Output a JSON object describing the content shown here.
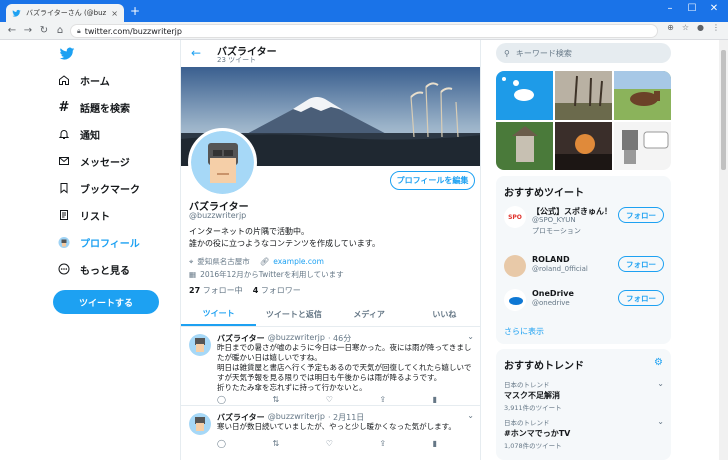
{
  "browser": {
    "tab_title": "バズライターさん (@buzzwriterjp) / T",
    "tab_close": "×",
    "new_tab": "+",
    "url": "twitter.com/buzzwriterjp",
    "win_min": "–",
    "win_max": "☐",
    "win_close": "✕"
  },
  "nav": {
    "items": [
      {
        "label": "ホーム"
      },
      {
        "label": "話題を検索"
      },
      {
        "label": "通知"
      },
      {
        "label": "メッセージ"
      },
      {
        "label": "ブックマーク"
      },
      {
        "label": "リスト"
      },
      {
        "label": "プロフィール"
      },
      {
        "label": "もっと見る"
      }
    ],
    "tweet_button": "ツイートする"
  },
  "header": {
    "name": "バズライター",
    "tweet_count": "23 ツイート"
  },
  "profile": {
    "edit_button": "プロフィールを編集",
    "name": "バズライター",
    "handle": "@buzzwriterjp",
    "bio_line1": "インターネットの片隅で活動中。",
    "bio_line2": "誰かの役に立つようなコンテンツを作成しています。",
    "location": "愛知県名古屋市",
    "website": "example.com",
    "joined": "2016年12月からTwitterを利用しています",
    "following_count": "27",
    "following_label": "フォロー中",
    "followers_count": "4",
    "followers_label": "フォロワー"
  },
  "tabs": [
    {
      "label": "ツイート"
    },
    {
      "label": "ツイートと返信"
    },
    {
      "label": "メディア"
    },
    {
      "label": "いいね"
    }
  ],
  "tweets": [
    {
      "name": "バズライター",
      "handle": "@buzzwriterjp",
      "time": "· 46分",
      "text": "昨日までの暑さが嘘のように今日は一日寒かった。夜には雨が降ってきましたが暖かい日は嬉しいですね。\n明日は雑貨屋と書店へ行く予定もあるので天気が回復してくれたら嬉しいですが天気予報を見る限りでは明日も午後からは雨が降るようです。\n折りたたみ傘を忘れずに持って行かないと。"
    },
    {
      "name": "バズライター",
      "handle": "@buzzwriterjp",
      "time": "· 2月11日",
      "text": "寒い日が数日続いていましたが、やっと少し暖かくなった気がします。"
    }
  ],
  "right": {
    "search_placeholder": "キーワード検索",
    "recommend_title": "おすすめツイート",
    "recommend": [
      {
        "name": "【公式】スポきゅん！",
        "handle": "@SPO_KYUN",
        "promo": "プロモーション",
        "button": "フォロー"
      },
      {
        "name": "ROLAND",
        "handle": "@roland_0fficial",
        "button": "フォロー"
      },
      {
        "name": "OneDrive",
        "handle": "@onedrive",
        "button": "フォロー"
      }
    ],
    "more": "さらに表示",
    "trends_title": "おすすめトレンド",
    "trends": [
      {
        "category": "日本のトレンド",
        "title": "マスク不足解消",
        "count": "3,911件のツイート"
      },
      {
        "category": "日本のトレンド",
        "title": "#ホンマでっかTV",
        "count": "1,078件のツイート"
      }
    ]
  },
  "colors": {
    "accent": "#1da1f2",
    "chrome": "#1a73e8"
  }
}
